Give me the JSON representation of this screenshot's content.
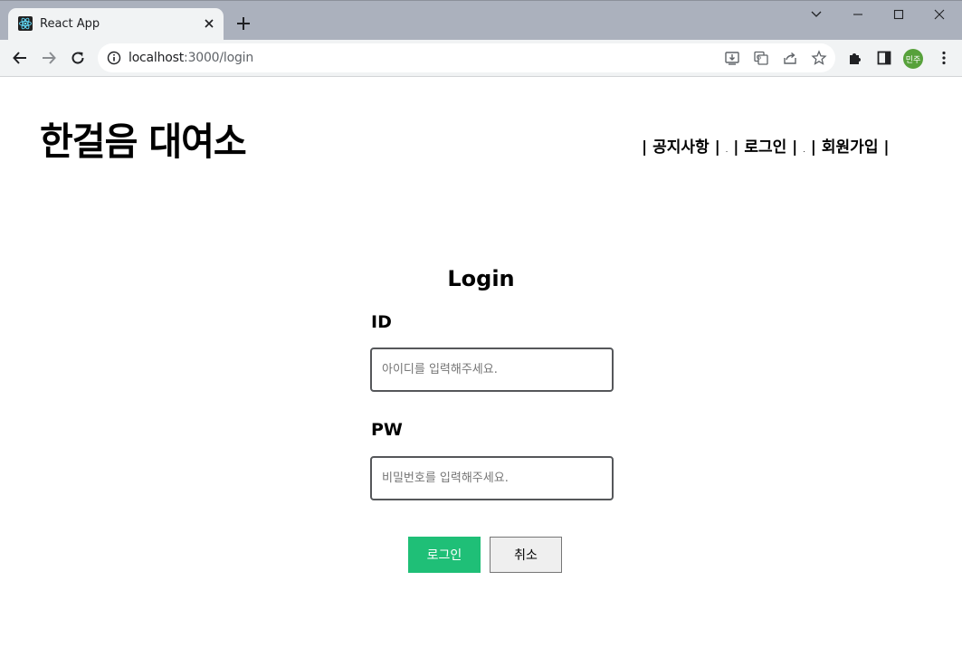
{
  "browser": {
    "tab_title": "React App",
    "url_host": "localhost",
    "url_path": ":3000/login",
    "profile_initials": "민주",
    "profile_color": "#57a13b"
  },
  "page": {
    "logo": "한걸음 대여소",
    "nav": {
      "notice": "공지사항",
      "login": "로그인",
      "signup": "회원가입"
    },
    "login_title": "Login",
    "id_label": "ID",
    "id_placeholder": "아이디를 입력해주세요.",
    "pw_label": "PW",
    "pw_placeholder": "비밀번호를 입력해주세요.",
    "login_button": "로그인",
    "cancel_button": "취소",
    "accent_color": "#1fbf77"
  }
}
